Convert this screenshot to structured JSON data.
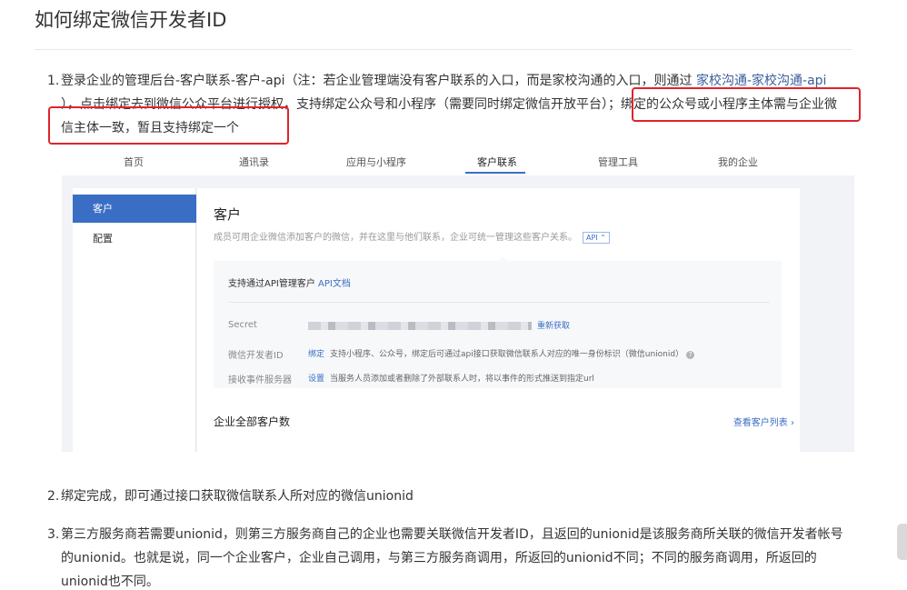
{
  "page": {
    "title": "如何绑定微信开发者ID"
  },
  "steps": [
    {
      "num": "1.",
      "line1": "登录企业的管理后台-客户联系-客户-api（注：若企业管理端没有客户联系的入口，而是家校沟通的入口，则通过",
      "line1_link": " 家校沟通-家校沟通-api",
      "line2": "），点击绑定去到微信公众平台进行授权，支持绑定公众号和小程序（需要同时绑定微信开放平台）；绑定的公众号或小程序主体需与企业微",
      "line3": "信主体一致，暂且支持绑定一个"
    },
    {
      "num": "2.",
      "text": "绑定完成，即可通过接口获取微信联系人所对应的微信unionid"
    },
    {
      "num": "3.",
      "line1": "第三方服务商若需要unionid，则第三方服务商自己的企业也需要关联微信开发者ID，且返回的unionid是该服务商所关联的微信开发者帐号",
      "line2": "的unionid。也就是说，同一个企业客户，企业自己调用，与第三方服务商调用，所返回的unionid不同；不同的服务商调用，所返回的",
      "line3": "unionid也不同。"
    }
  ],
  "screenshot": {
    "nav": [
      "首页",
      "通讯录",
      "应用与小程序",
      "客户联系",
      "管理工具",
      "我的企业"
    ],
    "active_nav": "客户联系",
    "sidebar": [
      "客户",
      "配置"
    ],
    "main_title": "客户",
    "main_desc": "成员可用企业微信添加客户的微信，并在这里与他们联系，企业可统一管理这些客户关系。",
    "api_tag": "API ⌃",
    "panel_head": "支持通过API管理客户",
    "panel_head_link": "API文档",
    "rows": [
      {
        "label": "Secret",
        "link": "重新获取",
        "desc": ""
      },
      {
        "label": "微信开发者ID",
        "link": "绑定",
        "desc": "支持小程序、公众号，绑定后可通过api接口获取微信联系人对应的唯一身份标识（微信unionid）"
      },
      {
        "label": "接收事件服务器",
        "link": "设置",
        "desc": "当服务人员添加或者删除了外部联系人时，将以事件的形式推送到指定url"
      }
    ],
    "count_title": "企业全部客户数",
    "view_link": "查看客户列表 ›"
  },
  "colors": {
    "accent": "#3a6ec4",
    "highlight": "#e0242a"
  }
}
